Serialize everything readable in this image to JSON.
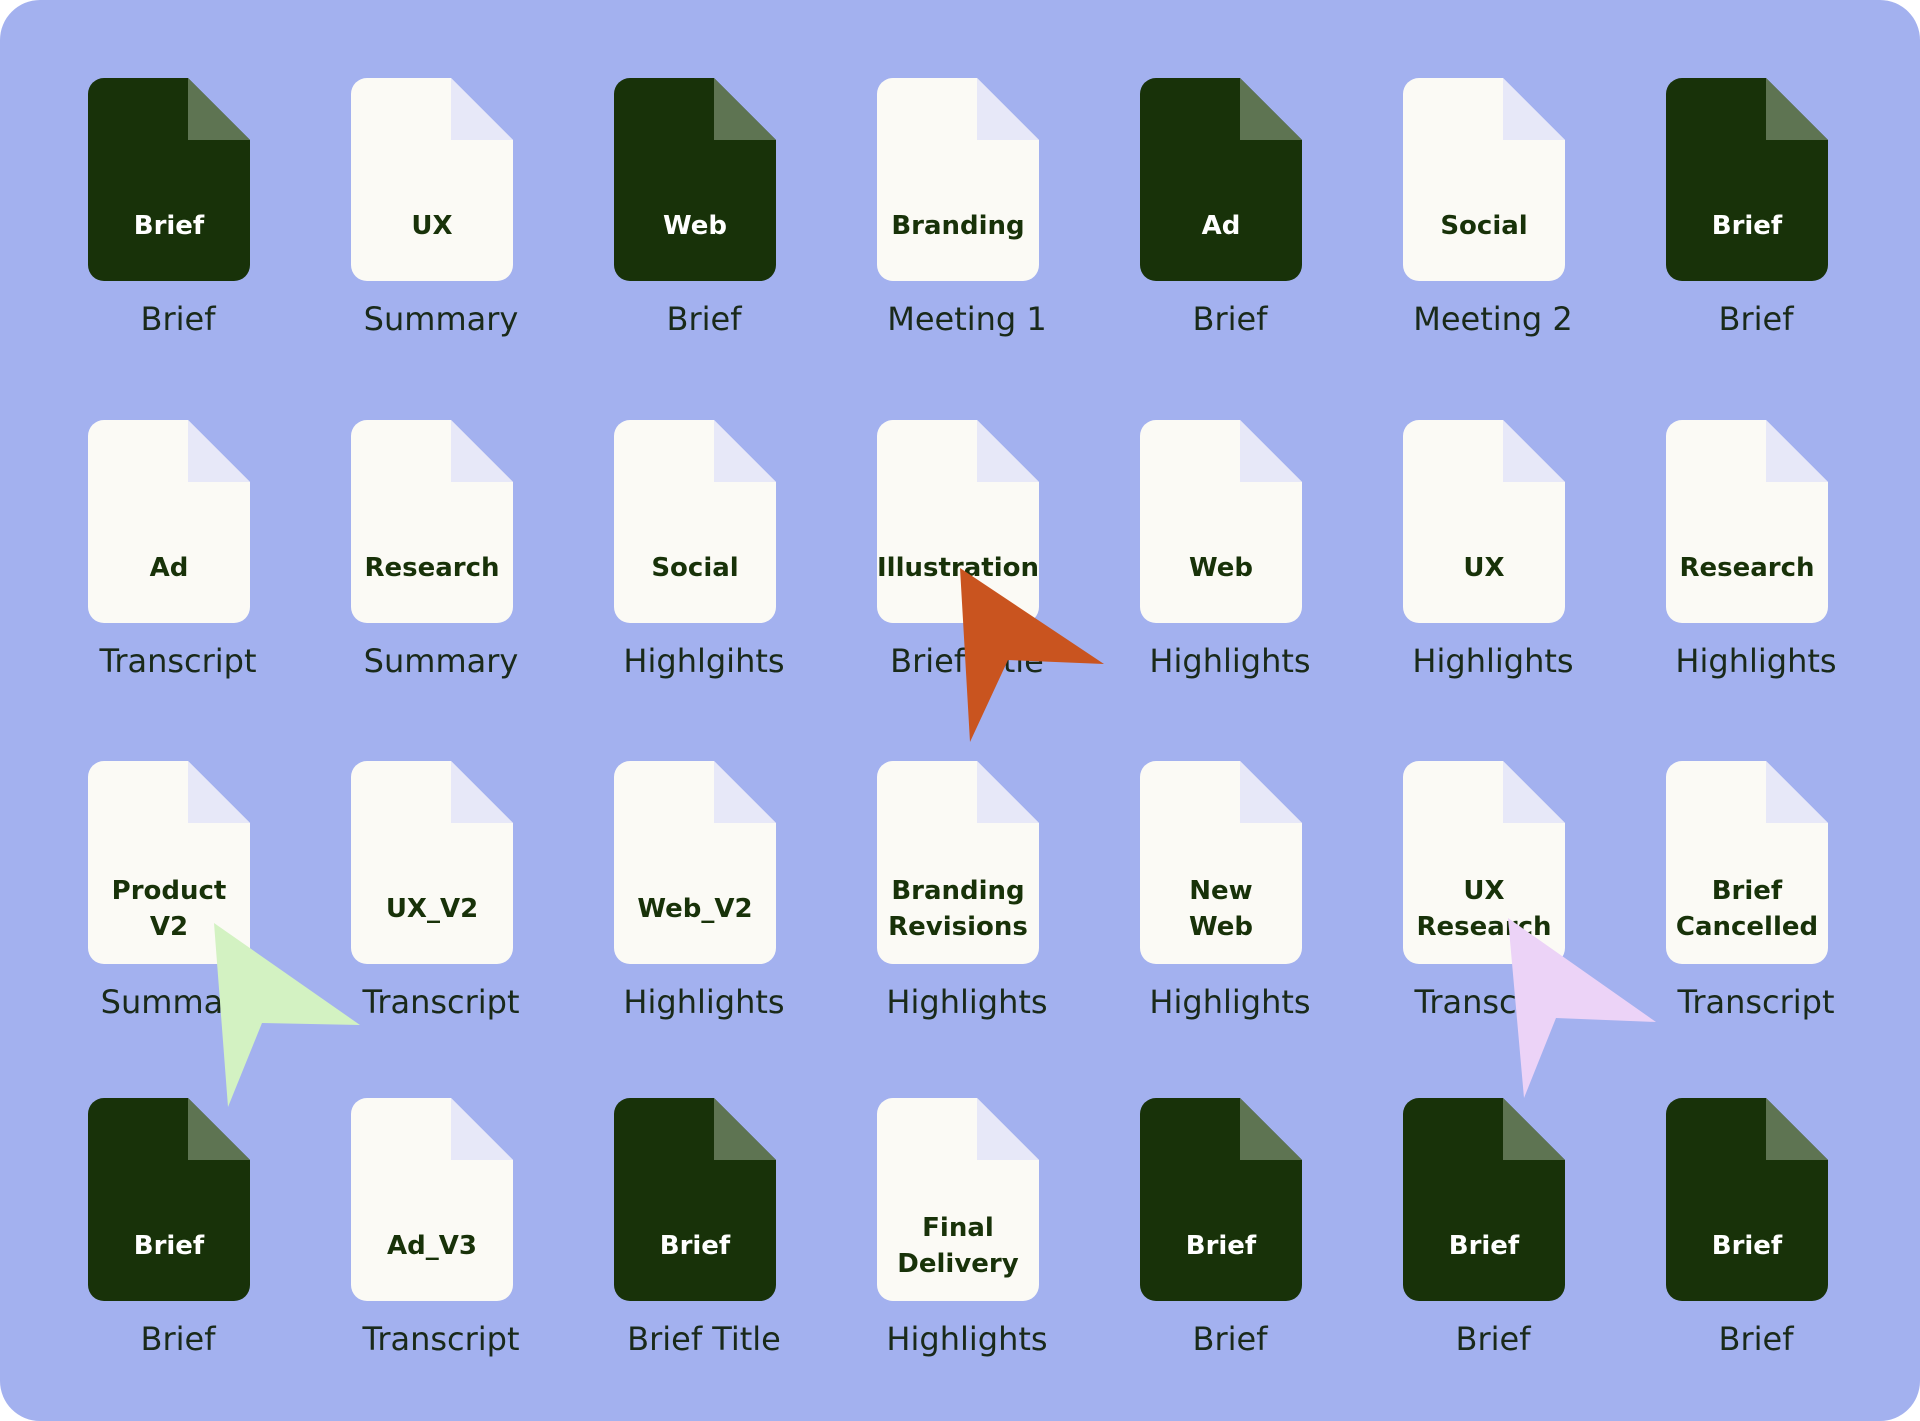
{
  "colors": {
    "background": "#a3b1ef",
    "dark_file": "#183209",
    "light_file": "#fbfaf5",
    "cursor_orange": "#c9541f",
    "cursor_green": "#d3f2c2",
    "cursor_lilac": "#ecd3f7"
  },
  "files": [
    {
      "tag": "Brief",
      "name": "Brief",
      "style": "dark"
    },
    {
      "tag": "UX",
      "name": "Summary",
      "style": "light"
    },
    {
      "tag": "Web",
      "name": "Brief",
      "style": "dark"
    },
    {
      "tag": "Branding",
      "name": "Meeting 1",
      "style": "light"
    },
    {
      "tag": "Ad",
      "name": "Brief",
      "style": "dark"
    },
    {
      "tag": "Social",
      "name": "Meeting 2",
      "style": "light"
    },
    {
      "tag": "Brief",
      "name": "Brief",
      "style": "dark"
    },
    {
      "tag": "Ad",
      "name": "Transcript",
      "style": "light"
    },
    {
      "tag": "Research",
      "name": "Summary",
      "style": "light"
    },
    {
      "tag": "Social",
      "name": "Highlgihts",
      "style": "light"
    },
    {
      "tag": "Illustration",
      "name": "Brief Title",
      "style": "light"
    },
    {
      "tag": "Web",
      "name": "Highlights",
      "style": "light"
    },
    {
      "tag": "UX",
      "name": "Highlights",
      "style": "light"
    },
    {
      "tag": "Research",
      "name": "Highlights",
      "style": "light"
    },
    {
      "tag": "Product\nV2",
      "name": "Summary",
      "style": "light"
    },
    {
      "tag": "UX_V2",
      "name": "Transcript",
      "style": "light"
    },
    {
      "tag": "Web_V2",
      "name": "Highlights",
      "style": "light"
    },
    {
      "tag": "Branding\nRevisions",
      "name": "Highlights",
      "style": "light"
    },
    {
      "tag": "New\nWeb",
      "name": "Highlights",
      "style": "light"
    },
    {
      "tag": "UX\nResearch",
      "name": "Transcript",
      "style": "light"
    },
    {
      "tag": "Brief\nCancelled",
      "name": "Transcript",
      "style": "light"
    },
    {
      "tag": "Brief",
      "name": "Brief",
      "style": "dark"
    },
    {
      "tag": "Ad_V3",
      "name": "Transcript",
      "style": "light"
    },
    {
      "tag": "Brief",
      "name": "Brief Title",
      "style": "dark"
    },
    {
      "tag": "Final\nDelivery",
      "name": "Highlights",
      "style": "light"
    },
    {
      "tag": "Brief",
      "name": "Brief",
      "style": "dark"
    },
    {
      "tag": "Brief",
      "name": "Brief",
      "style": "dark"
    },
    {
      "tag": "Brief",
      "name": "Brief",
      "style": "dark"
    }
  ],
  "cursors": [
    {
      "icon": "cursor-arrow-icon",
      "color": "#c9541f"
    },
    {
      "icon": "cursor-arrow-icon",
      "color": "#d3f2c2"
    },
    {
      "icon": "cursor-arrow-icon",
      "color": "#ecd3f7"
    }
  ]
}
